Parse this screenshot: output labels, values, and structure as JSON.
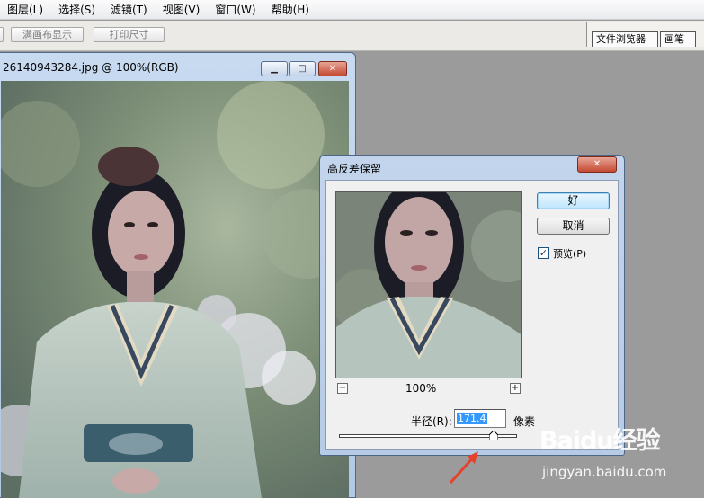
{
  "menu": [
    "图层(L)",
    "选择(S)",
    "滤镜(T)",
    "视图(V)",
    "窗口(W)",
    "帮助(H)"
  ],
  "options": {
    "fit_screen": "满画布显示",
    "print_size": "打印尺寸"
  },
  "palette_tabs": [
    "文件浏览器",
    "画笔"
  ],
  "document": {
    "title": "26140943284.jpg @ 100%(RGB)",
    "minimize_glyph": "▁",
    "maximize_glyph": "□",
    "close_glyph": "✕"
  },
  "dialog": {
    "title": "高反差保留",
    "close_glyph": "✕",
    "ok": "好",
    "cancel": "取消",
    "preview_checked": true,
    "preview_label": "预览(P)",
    "check_glyph": "✓",
    "zoom": "100%",
    "zoom_out": "−",
    "zoom_in": "+",
    "radius_label": "半径(R):",
    "radius_value": "171.4",
    "radius_unit": "像素",
    "slider_level": 0.87
  },
  "watermark": {
    "logo": "Baidu经验",
    "url": "jingyan.baidu.com"
  },
  "colors": {
    "titlebar": "#c3d5ec",
    "close": "#c44a33",
    "arrow": "#e5412c",
    "selection": "#3399ff"
  }
}
